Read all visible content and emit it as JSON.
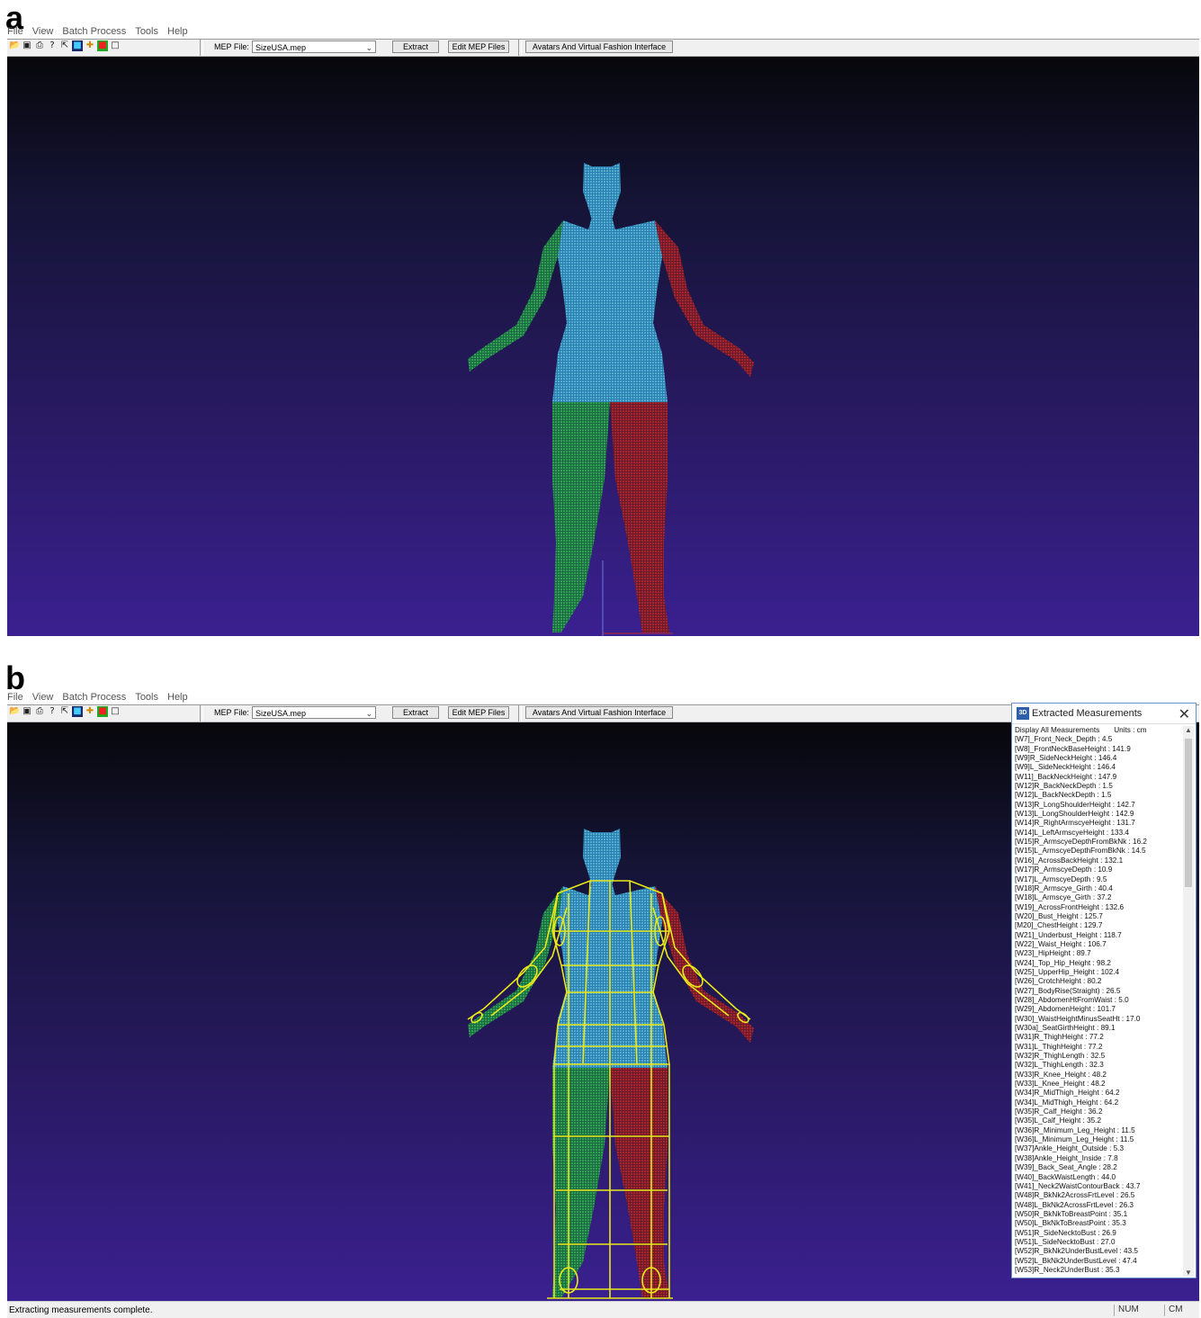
{
  "panels": {
    "a_label": "a",
    "b_label": "b"
  },
  "menu": [
    "File",
    "View",
    "Batch Process",
    "Tools",
    "Help"
  ],
  "toolbar": {
    "icons": [
      "open-icon",
      "save-icon",
      "print-icon",
      "help-icon",
      "context-help-icon",
      "scan-icon",
      "measure-icon",
      "color-icon",
      "blank-icon"
    ],
    "mep_label": "MEP File:",
    "mep_value": "SizeUSA.mep",
    "extract_label": "Extract",
    "edit_mep_label": "Edit MEP Files",
    "avatars_label": "Avatars And Virtual Fashion Interface"
  },
  "dialog": {
    "title": "Extracted Measurements",
    "header_left": "Display All Measurements",
    "header_right": "Units : cm",
    "measurements": [
      "[W7]_Front_Neck_Depth : 4.5",
      "[W8]_FrontNeckBaseHeight : 141.9",
      "[W9]R_SideNeckHeight : 146.4",
      "[W9]L_SideNeckHeight : 146.4",
      "[W11]_BackNeckHeight : 147.9",
      "[W12]R_BackNeckDepth : 1.5",
      "[W12]L_BackNeckDepth : 1.5",
      "[W13]R_LongShoulderHeight : 142.7",
      "[W13]L_LongShoulderHeight : 142.9",
      "[W14]R_RightArmscyeHeight : 131.7",
      "[W14]L_LeftArmscyeHeight : 133.4",
      "[W15]R_ArmscyeDepthFromBkNk : 16.2",
      "[W15]L_ArmscyeDepthFromBkNk : 14.5",
      "[W16]_AcrossBackHeight : 132.1",
      "[W17]R_ArmscyeDepth : 10.9",
      "[W17]L_ArmscyeDepth : 9.5",
      "[W18]R_Armscye_Girth : 40.4",
      "[W18]L_Armscye_Girth : 37.2",
      "[W19]_AcrossFrontHeight : 132.6",
      "[W20]_Bust_Height : 125.7",
      "[M20]_ChestHeight : 129.7",
      "[W21]_Underbust_Height : 118.7",
      "[W22]_Waist_Height : 106.7",
      "[W23]_HipHeight : 89.7",
      "[W24]_Top_Hip_Height : 98.2",
      "[W25]_UpperHip_Height : 102.4",
      "[W26]_CrotchHeight : 80.2",
      "[W27]_BodyRise(Straight) : 26.5",
      "[W28]_AbdomenHtFromWaist : 5.0",
      "[W29]_AbdomenHeight : 101.7",
      "[W30]_WaistHeightMinusSeatHt : 17.0",
      "[W30a]_SeatGirthHeight : 89.1",
      "[W31]R_ThighHeight : 77.2",
      "[W31]L_ThighHeight : 77.2",
      "[W32]R_ThighLength : 32.5",
      "[W32]L_ThighLength : 32.3",
      "[W33]R_Knee_Height : 48.2",
      "[W33]L_Knee_Height : 48.2",
      "[W34]R_MidThigh_Height : 64.2",
      "[W34]L_MidThigh_Height : 64.2",
      "[W35]R_Calf_Height : 36.2",
      "[W35]L_Calf_Height : 35.2",
      "[W36]R_Minimum_Leg_Height : 11.5",
      "[W36]L_Minimum_Leg_Height : 11.5",
      "[W37]Ankle_Height_Outside : 5.3",
      "[W38]Ankle_Height_Inside : 7.8",
      "[W39]_Back_Seat_Angle : 28.2",
      "[W40]_BackWaistLength : 44.0",
      "[W41]_Neck2WaistContourBack : 43.7",
      "[W48]R_BkNk2AcrossFrtLevel : 26.5",
      "[W48]L_BkNk2AcrossFrtLevel : 26.3",
      "[W50]R_BkNkToBreastPoint : 35.1",
      "[W50]L_BkNkToBreastPoint : 35.3",
      "[W51]R_SideNecktoBust : 26.9",
      "[W51]L_SideNecktoBust : 27.0",
      "[W52]R_BkNk2UnderBustLevel : 43.5",
      "[W52]L_BkNk2UnderBustLevel : 47.4",
      "[W53]R_Neck2UnderBust : 35.3"
    ]
  },
  "status": {
    "message": "Extracting measurements complete.",
    "num": "NUM",
    "units": "CM"
  },
  "colors": {
    "left_side": "#22c64a",
    "right_side": "#d42020",
    "torso": "#3fb8d8",
    "wireframe": "#e8e81a"
  }
}
